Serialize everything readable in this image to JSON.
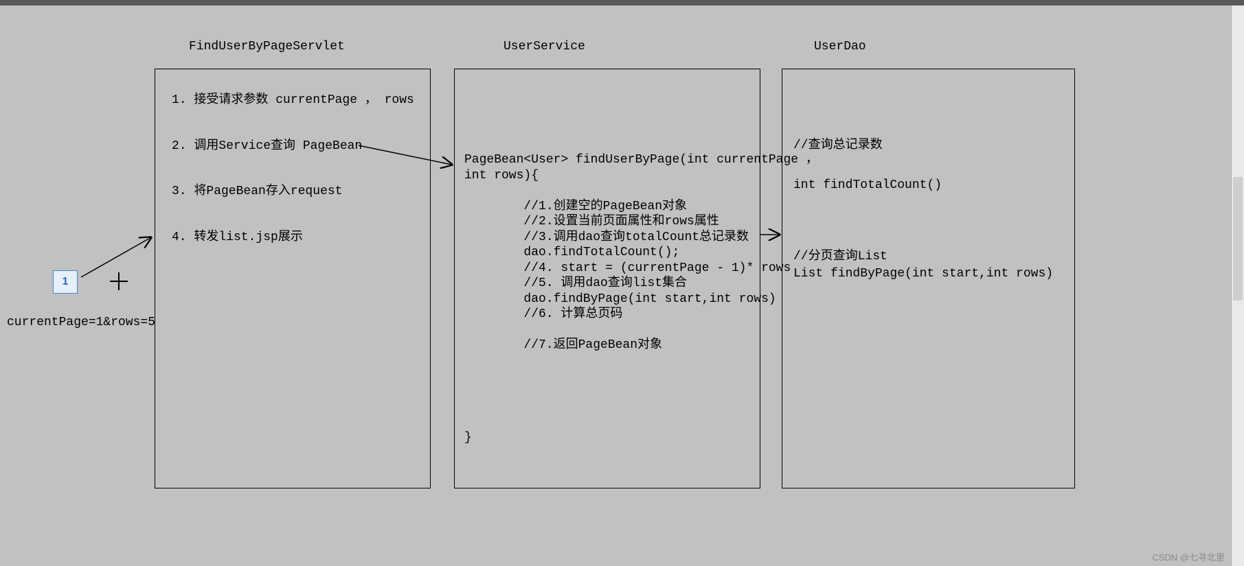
{
  "pager": {
    "number": "1"
  },
  "param_line": "currentPage=1&rows=5",
  "servlet": {
    "title": "FindUserByPageServlet",
    "lines": "1. 接受请求参数 currentPage ， rows\n\n2. 调用Service查询 PageBean\n\n3. 将PageBean存入request\n\n4. 转发list.jsp展示"
  },
  "service": {
    "title": "UserService",
    "code": "PageBean<User> findUserByPage(int currentPage ，\nint rows){\n\n        //1.创建空的PageBean对象\n        //2.设置当前页面属性和rows属性\n        //3.调用dao查询totalCount总记录数\n        dao.findTotalCount();\n        //4. start = (currentPage - 1)* rows\n        //5. 调用dao查询list集合\n        dao.findByPage(int start,int rows)\n        //6. 计算总页码\n\n        //7.返回PageBean对象\n\n\n\n\n\n}"
  },
  "dao": {
    "title": "UserDao",
    "block1": "//查询总记录数\n\nint findTotalCount()",
    "block2": "//分页查询List\nList findByPage(int start,int rows)"
  },
  "watermark": "CSDN @七寻北里"
}
